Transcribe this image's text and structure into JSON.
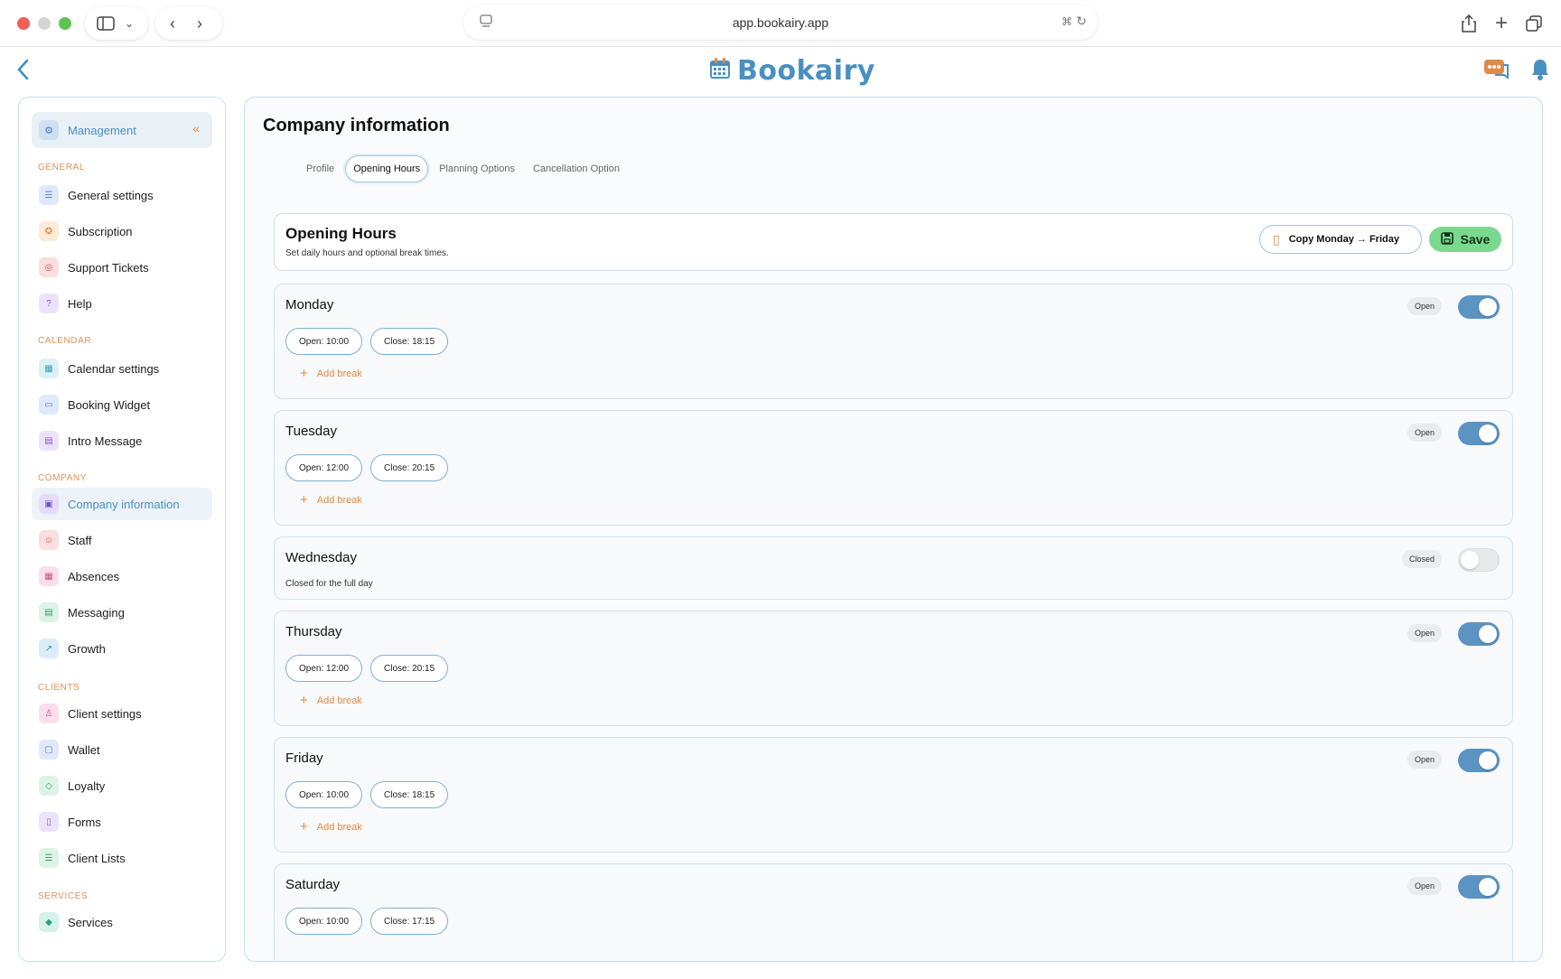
{
  "browser": {
    "url": "app.bookairy.app"
  },
  "header": {
    "logo_text": "Bookairy"
  },
  "sidebar": {
    "management_label": "Management",
    "sections": [
      {
        "label": "GENERAL",
        "items": [
          {
            "label": "General settings",
            "icon": "sliders-icon",
            "color": "#dfe9fb"
          },
          {
            "label": "Subscription",
            "icon": "badge-icon",
            "color": "#fcebd6"
          },
          {
            "label": "Support Tickets",
            "icon": "lifebuoy-icon",
            "color": "#fbdede"
          },
          {
            "label": "Help",
            "icon": "help-icon",
            "color": "#ece3fb"
          }
        ]
      },
      {
        "label": "CALENDAR",
        "items": [
          {
            "label": "Calendar settings",
            "icon": "calendar-icon",
            "color": "#dcf0f5"
          },
          {
            "label": "Booking Widget",
            "icon": "widget-icon",
            "color": "#dfe9fb"
          },
          {
            "label": "Intro Message",
            "icon": "message-icon",
            "color": "#ece3fb"
          }
        ]
      },
      {
        "label": "COMPANY",
        "items": [
          {
            "label": "Company information",
            "icon": "building-icon",
            "color": "#e3dcfb",
            "active": true
          },
          {
            "label": "Staff",
            "icon": "users-icon",
            "color": "#fbdede"
          },
          {
            "label": "Absences",
            "icon": "calendar-x-icon",
            "color": "#fbdeea"
          },
          {
            "label": "Messaging",
            "icon": "chat-icon",
            "color": "#dcf3e6"
          },
          {
            "label": "Growth",
            "icon": "trend-icon",
            "color": "#dcedf8"
          }
        ]
      },
      {
        "label": "CLIENTS",
        "items": [
          {
            "label": "Client settings",
            "icon": "user-icon",
            "color": "#fbdeea"
          },
          {
            "label": "Wallet",
            "icon": "wallet-icon",
            "color": "#dfe9fb"
          },
          {
            "label": "Loyalty",
            "icon": "tag-icon",
            "color": "#dcf3e6"
          },
          {
            "label": "Forms",
            "icon": "form-icon",
            "color": "#ece3fb"
          },
          {
            "label": "Client Lists",
            "icon": "list-icon",
            "color": "#dcf3e6"
          }
        ]
      },
      {
        "label": "SERVICES",
        "items": [
          {
            "label": "Services",
            "icon": "diamond-icon",
            "color": "#d6f1ea"
          }
        ]
      }
    ]
  },
  "main": {
    "title": "Company information",
    "tabs": [
      {
        "label": "Profile",
        "active": false
      },
      {
        "label": "Opening Hours",
        "active": true
      },
      {
        "label": "Planning Options",
        "active": false
      },
      {
        "label": "Cancellation Option",
        "active": false
      }
    ],
    "opening_hours": {
      "title": "Opening Hours",
      "subtitle": "Set daily hours and optional break times.",
      "copy_label": "Copy Monday → Friday",
      "save_label": "Save"
    },
    "add_break_label": "Add break",
    "days": [
      {
        "name": "Monday",
        "status": "Open",
        "open": "Open: 10:00",
        "close": "Close: 18:15",
        "enabled": true
      },
      {
        "name": "Tuesday",
        "status": "Open",
        "open": "Open: 12:00",
        "close": "Close: 20:15",
        "enabled": true
      },
      {
        "name": "Wednesday",
        "status": "Closed",
        "note": "Closed for the full day",
        "enabled": false
      },
      {
        "name": "Thursday",
        "status": "Open",
        "open": "Open: 12:00",
        "close": "Close: 20:15",
        "enabled": true
      },
      {
        "name": "Friday",
        "status": "Open",
        "open": "Open: 10:00",
        "close": "Close: 18:15",
        "enabled": true
      },
      {
        "name": "Saturday",
        "status": "Open",
        "open": "Open: 10:00",
        "close": "Close: 17:15",
        "enabled": true
      }
    ]
  }
}
